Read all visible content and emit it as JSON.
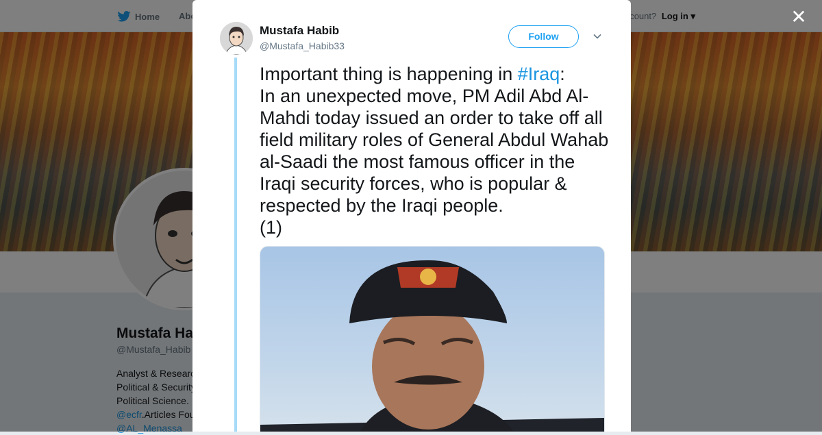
{
  "topnav": {
    "home_label": "Home",
    "about_label": "Abo",
    "account_text": "ccount?",
    "login_label": "Log in"
  },
  "profile": {
    "name": "Mustafa Ha",
    "handle": "@Mustafa_Habib",
    "bio_lines": [
      "Analyst & Researc",
      "Political & Security",
      "Political Science. "
    ],
    "bio_link_1": "@ecfr",
    "bio_link_1_suffix": ".Articles Fou",
    "bio_link_2": "@AL_Menassa"
  },
  "modal": {
    "close_icon": "close-icon",
    "author_name": "Mustafa Habib",
    "author_handle": "@Mustafa_Habib33",
    "follow_label": "Follow",
    "tweet_prefix": "Important thing is happening in ",
    "tweet_hashtag": "#Iraq",
    "tweet_body": ":\nIn an unexpected move, PM Adil Abd Al-Mahdi today issued an order to take off all field military roles of General Abdul Wahab al-Saadi the most famous officer in the Iraqi security forces, who is popular & respected by the Iraqi people.\n(1)"
  },
  "colors": {
    "accent": "#1da1f2",
    "thread_line": "#a7dbf8",
    "overlay": "rgba(0,0,0,0.5)"
  }
}
